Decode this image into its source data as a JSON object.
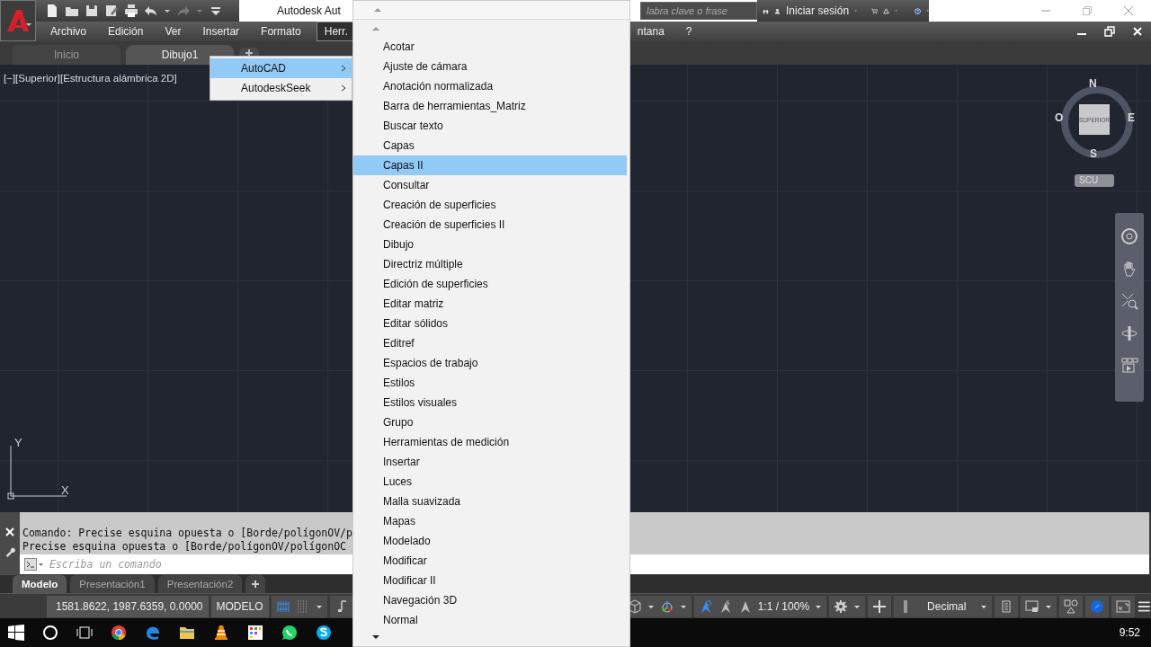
{
  "title_bar": {
    "title": "Autodesk Aut",
    "search": {
      "placeholder": "labra clave o frase"
    },
    "sign_in": "Iniciar sesión"
  },
  "menu_bar": {
    "items": [
      {
        "label": "Archivo",
        "selected": false
      },
      {
        "label": "Edición",
        "selected": false
      },
      {
        "label": "Ver",
        "selected": false
      },
      {
        "label": "Insertar",
        "selected": false
      },
      {
        "label": "Formato",
        "selected": false
      },
      {
        "label": "Herr.",
        "selected": true
      }
    ],
    "items_right": [
      {
        "label": "ntana",
        "selected": false
      },
      {
        "label": "?",
        "selected": false
      }
    ]
  },
  "doc_tabs": [
    {
      "label": "Inicio",
      "selected": false
    },
    {
      "label": "Dibujo1",
      "selected": true
    }
  ],
  "viewport_label": "[−][Superior][Estructura alámbrica 2D]",
  "submenu": {
    "items": [
      {
        "label": "AutoCAD",
        "selected": true
      },
      {
        "label": "AutodeskSeek",
        "selected": false
      }
    ]
  },
  "toolbar_list": {
    "items": [
      {
        "label": "Acotar",
        "selected": false
      },
      {
        "label": "Ajuste de cámara",
        "selected": false
      },
      {
        "label": "Anotación normalizada",
        "selected": false
      },
      {
        "label": "Barra de herramientas_Matriz",
        "selected": false
      },
      {
        "label": "Buscar texto",
        "selected": false
      },
      {
        "label": "Capas",
        "selected": false
      },
      {
        "label": "Capas II",
        "selected": true
      },
      {
        "label": "Consultar",
        "selected": false
      },
      {
        "label": "Creación de superficies",
        "selected": false
      },
      {
        "label": "Creación de superficies II",
        "selected": false
      },
      {
        "label": "Dibujo",
        "selected": false
      },
      {
        "label": "Directriz múltiple",
        "selected": false
      },
      {
        "label": "Edición de superficies",
        "selected": false
      },
      {
        "label": "Editar matriz",
        "selected": false
      },
      {
        "label": "Editar sólidos",
        "selected": false
      },
      {
        "label": "Editref",
        "selected": false
      },
      {
        "label": "Espacios de trabajo",
        "selected": false
      },
      {
        "label": "Estilos",
        "selected": false
      },
      {
        "label": "Estilos visuales",
        "selected": false
      },
      {
        "label": "Grupo",
        "selected": false
      },
      {
        "label": "Herramientas de medición",
        "selected": false
      },
      {
        "label": "Insertar",
        "selected": false
      },
      {
        "label": "Luces",
        "selected": false
      },
      {
        "label": "Malla suavizada",
        "selected": false
      },
      {
        "label": "Mapas",
        "selected": false
      },
      {
        "label": "Modelado",
        "selected": false
      },
      {
        "label": "Modificar",
        "selected": false
      },
      {
        "label": "Modificar II",
        "selected": false
      },
      {
        "label": "Navegación 3D",
        "selected": false
      },
      {
        "label": "Normal",
        "selected": false
      }
    ]
  },
  "viewcube": {
    "north": "N",
    "south": "S",
    "east": "E",
    "west": "O",
    "face": "SUPERIOR",
    "ucs": "SCU"
  },
  "ucs_axes": {
    "x": "X",
    "y": "Y"
  },
  "command": {
    "history": [
      "Comando: Precise esquina opuesta o [Borde/polígonOV/p",
      "Precise esquina opuesta o [Borde/polígonOV/polígonOC"
    ],
    "placeholder": "Escriba un comando"
  },
  "layout_tabs": [
    {
      "label": "Modelo",
      "selected": true
    },
    {
      "label": "Presentación1",
      "selected": false
    },
    {
      "label": "Presentación2",
      "selected": false
    }
  ],
  "status_bar": {
    "coordinates": "1581.8622, 1987.6359, 0.0000",
    "space": "MODELO",
    "scale": "1:1 / 100%",
    "units": "Decimal"
  },
  "taskbar": {
    "time": "9:52"
  }
}
